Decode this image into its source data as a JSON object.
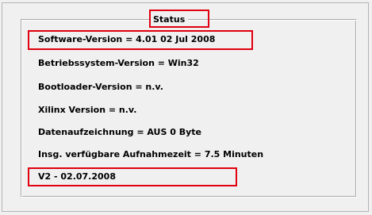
{
  "status": {
    "title": "Status",
    "software_version": "Software-Version = 4.01 02 Jul 2008",
    "os_version": "Betriebssystem-Version = Win32",
    "bootloader_version": "Bootloader-Version = n.v.",
    "xilinx_version": "Xilinx Version = n.v.",
    "recording": "Datenaufzeichnung = AUS  0 Byte",
    "available_time": "Insg. verfügbare Aufnahmezeit = 7.5 Minuten",
    "build": "V2 - 02.07.2008"
  },
  "colors": {
    "highlight": "#e0000f",
    "background": "#f0f0f0"
  }
}
